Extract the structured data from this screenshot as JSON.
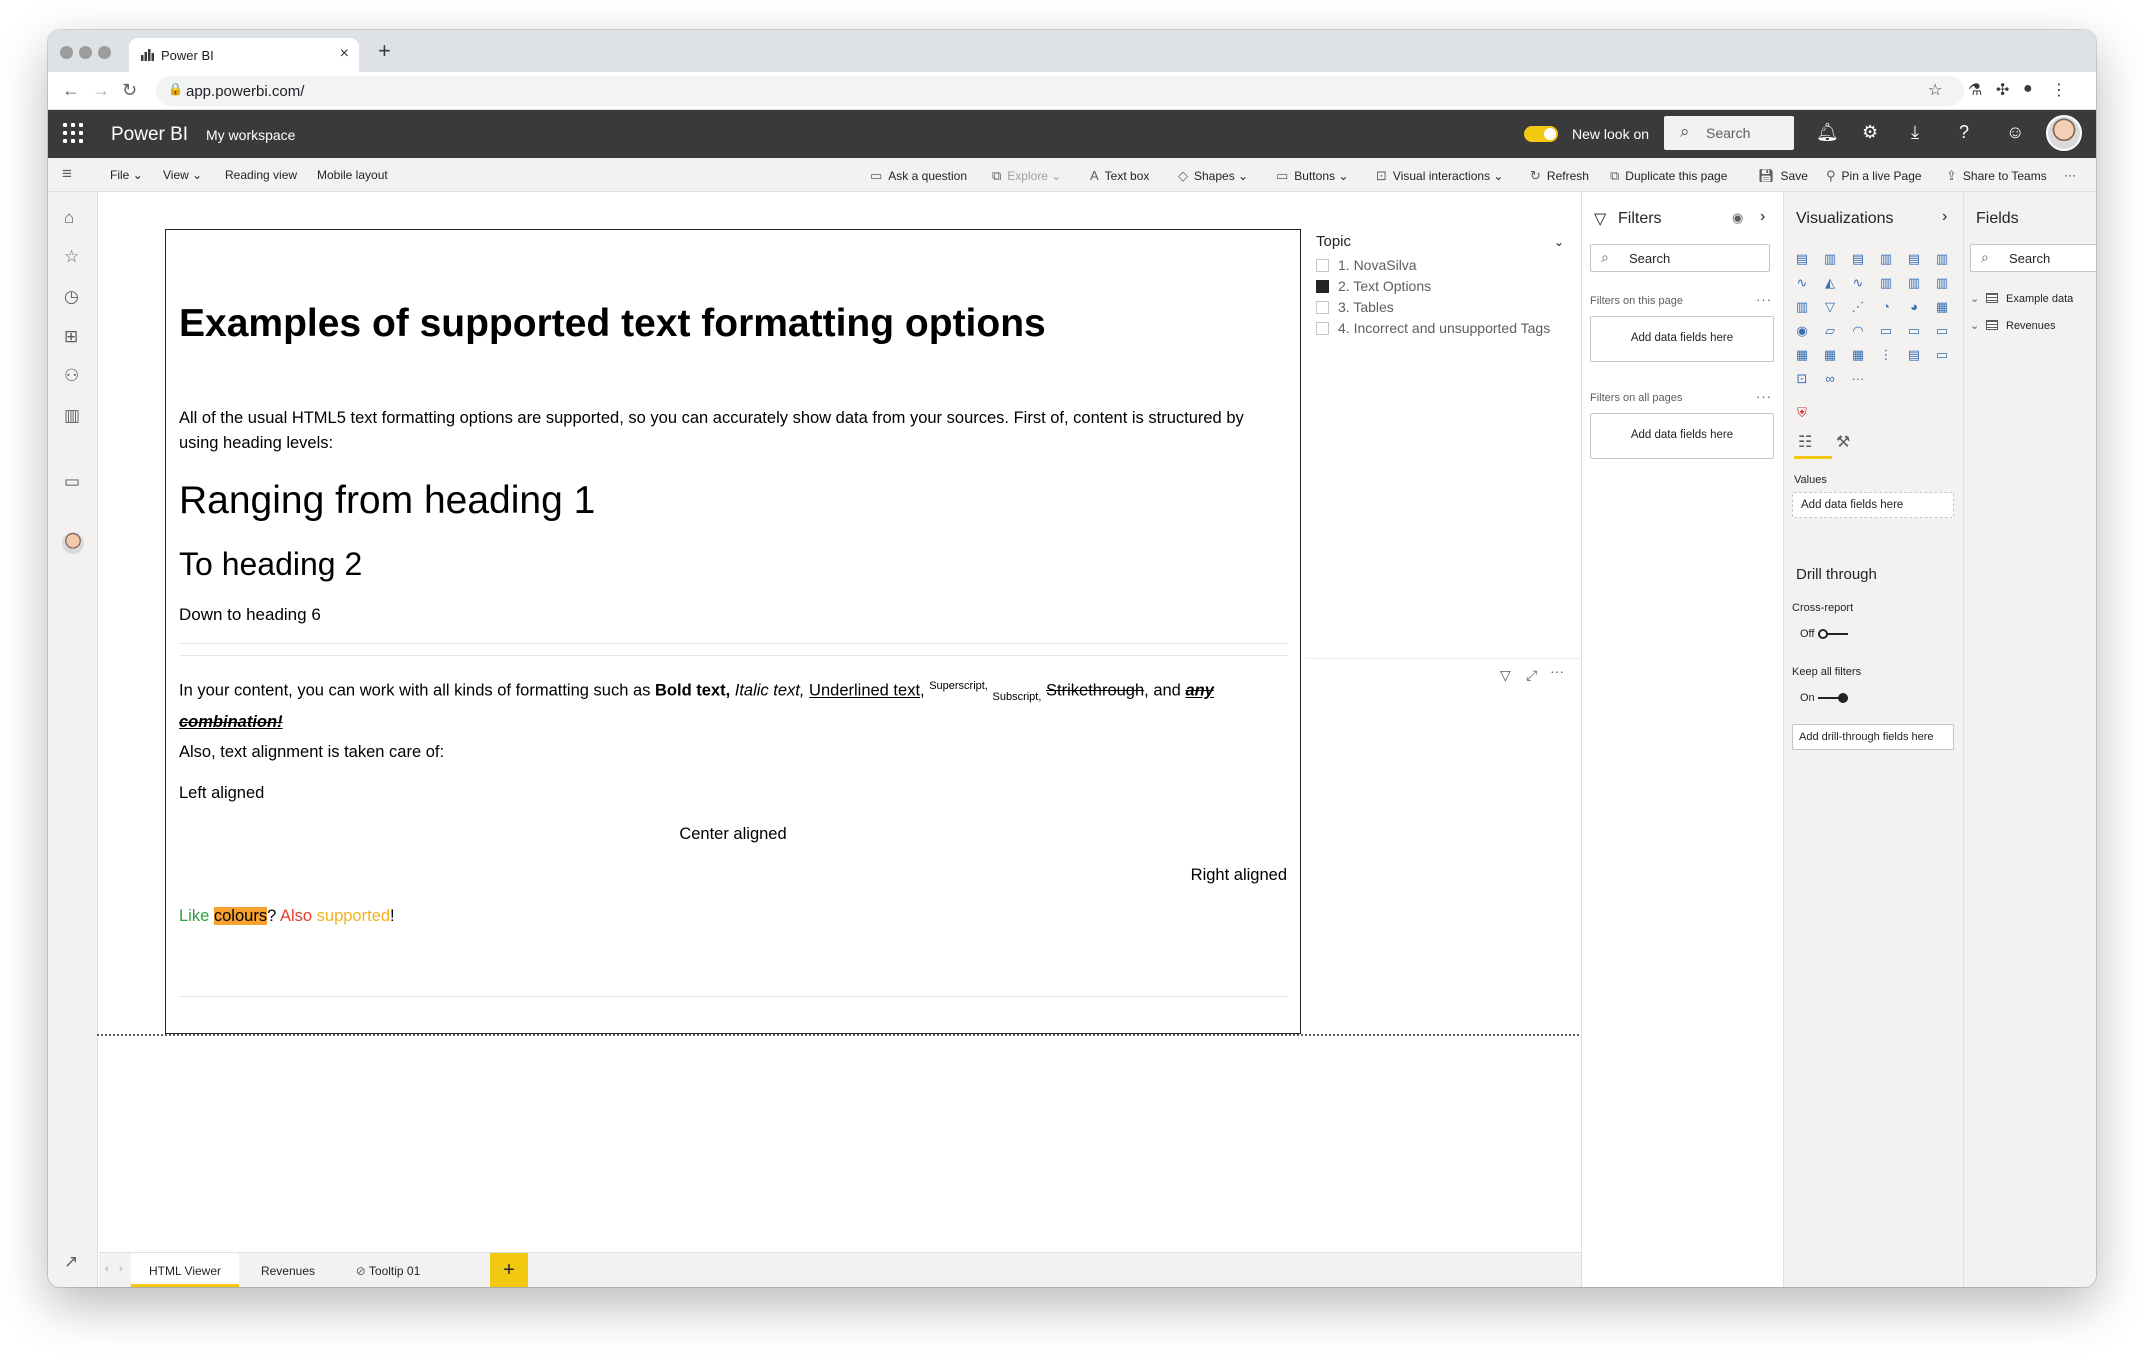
{
  "browser": {
    "tab_title": "Power BI",
    "url": "app.powerbi.com/"
  },
  "header": {
    "brand": "Power BI",
    "workspace": "My workspace",
    "new_look": "New look on",
    "search_placeholder": "Search"
  },
  "ribbon": {
    "file": "File",
    "view": "View",
    "reading_view": "Reading view",
    "mobile_layout": "Mobile layout",
    "ask_question": "Ask a question",
    "explore": "Explore",
    "text_box": "Text box",
    "shapes": "Shapes",
    "buttons": "Buttons",
    "visual_interactions": "Visual interactions",
    "refresh": "Refresh",
    "duplicate_page": "Duplicate this page",
    "save": "Save",
    "pin_live_page": "Pin a live Page",
    "share_teams": "Share to Teams"
  },
  "html_viewer": {
    "h1": "Examples of supported text formatting options",
    "intro": "All of the usual HTML5 text formatting options are supported, so you can accurately show data from your sources. First of, content is structured by using heading levels:",
    "heading1": "Ranging from heading 1",
    "heading2": "To heading 2",
    "heading6": "Down to heading 6",
    "fmt_prefix": "In your content, you can work with all kinds of formatting such as ",
    "bold": "Bold text,",
    "italic": "Italic text,",
    "underlined": "Underlined text",
    "superscript": "Superscript,",
    "subscript": "Subscript,",
    "strikethrough": "Strikethrough",
    "and": ", and ",
    "combo": "any combination!",
    "alignment": "Also, text alignment is taken care of:",
    "left": "Left aligned",
    "center": "Center aligned",
    "right": "Right aligned",
    "like": "Like",
    "colours": "colours",
    "q": "?",
    "also": "Also",
    "supported": "supported",
    "bang": "!"
  },
  "slicer": {
    "title": "Topic",
    "items": [
      {
        "label": "1. NovaSilva",
        "checked": false
      },
      {
        "label": "2. Text Options",
        "checked": true
      },
      {
        "label": "3. Tables",
        "checked": false
      },
      {
        "label": "4. Incorrect and unsupported Tags",
        "checked": false
      }
    ]
  },
  "filters": {
    "title": "Filters",
    "search": "Search",
    "on_this_page": "Filters on this page",
    "on_all_pages": "Filters on all pages",
    "add_fields": "Add data fields here"
  },
  "visualizations": {
    "title": "Visualizations",
    "values_label": "Values",
    "add_fields": "Add data fields here",
    "drill_through": "Drill through",
    "cross_report": "Cross-report",
    "cross_report_state": "Off",
    "keep_filters": "Keep all filters",
    "keep_filters_state": "On",
    "add_drill": "Add drill-through fields here"
  },
  "fields": {
    "title": "Fields",
    "search": "Search",
    "tables": [
      "Example data",
      "Revenues"
    ]
  },
  "page_tabs": [
    "HTML Viewer",
    "Revenues",
    "Tooltip 01"
  ],
  "colors": {
    "brand_yellow": "#f2c811",
    "header_bg": "#3a3a3a",
    "green": "#2ea043",
    "orange_highlight": "#f7a130",
    "red": "#e23c2d",
    "gold": "#f2b01e"
  }
}
